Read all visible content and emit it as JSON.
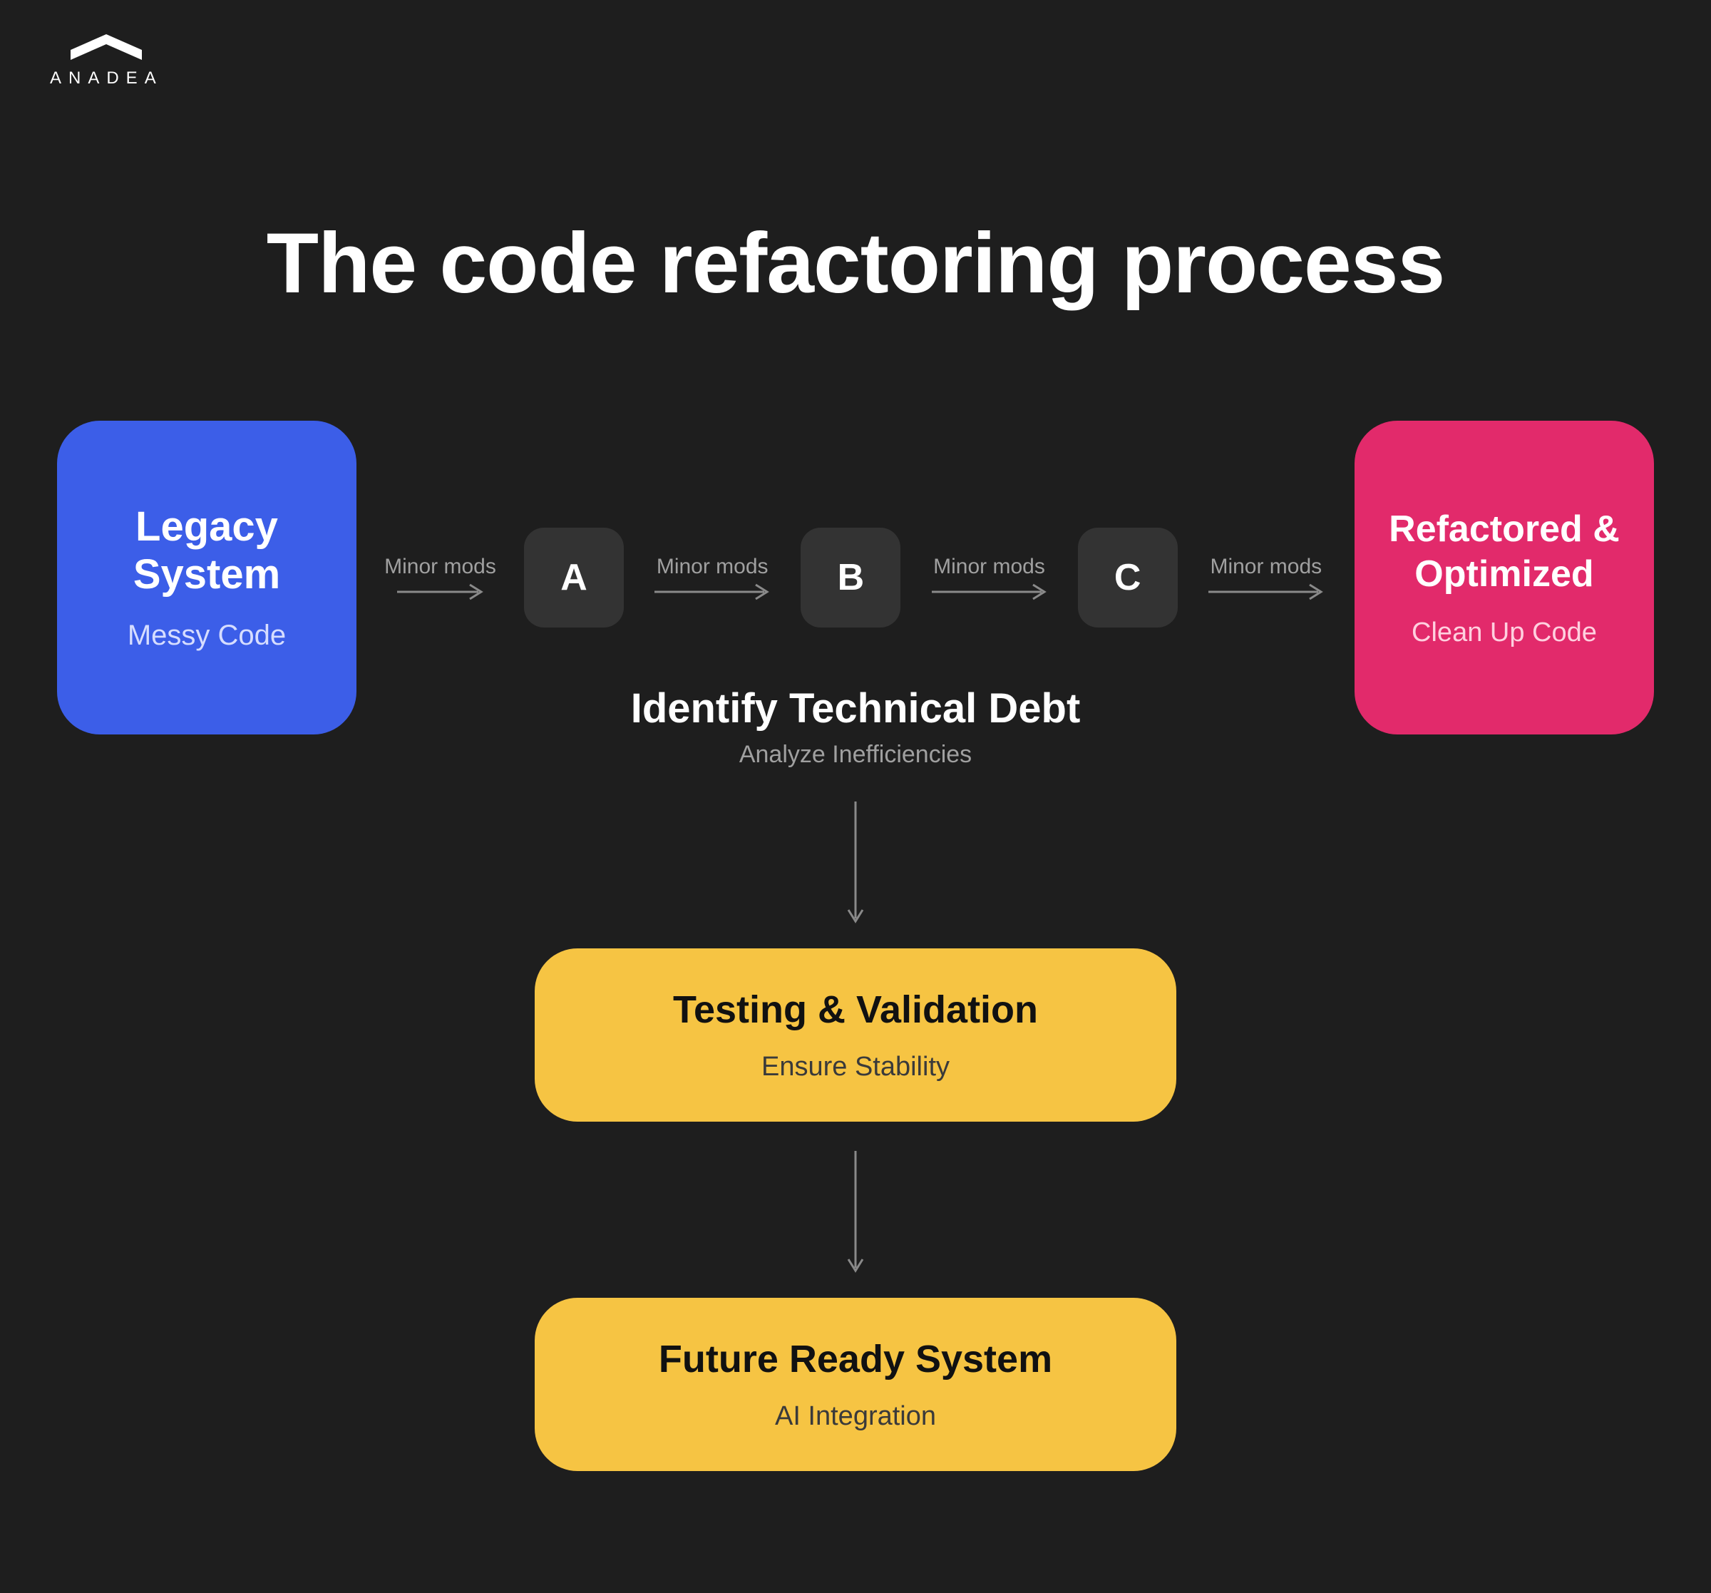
{
  "brand": "ANADEA",
  "title": "The code refactoring process",
  "flow": {
    "start": {
      "title": "Legacy System",
      "subtitle": "Messy Code"
    },
    "end": {
      "title": "Refactored & Optimized",
      "subtitle": "Clean Up Code"
    },
    "steps": [
      "A",
      "B",
      "C"
    ],
    "arrow_label": "Minor mods"
  },
  "identify": {
    "title": "Identify Technical Debt",
    "subtitle": "Analyze Inefficiencies"
  },
  "testing": {
    "title": "Testing & Validation",
    "subtitle": "Ensure Stability"
  },
  "future": {
    "title": "Future Ready System",
    "subtitle": "AI Integration"
  },
  "colors": {
    "background": "#1e1e1e",
    "legacy": "#3c5ee8",
    "refactored": "#e22a6b",
    "accent": "#f6c443",
    "arrow": "#8a8a8a"
  }
}
